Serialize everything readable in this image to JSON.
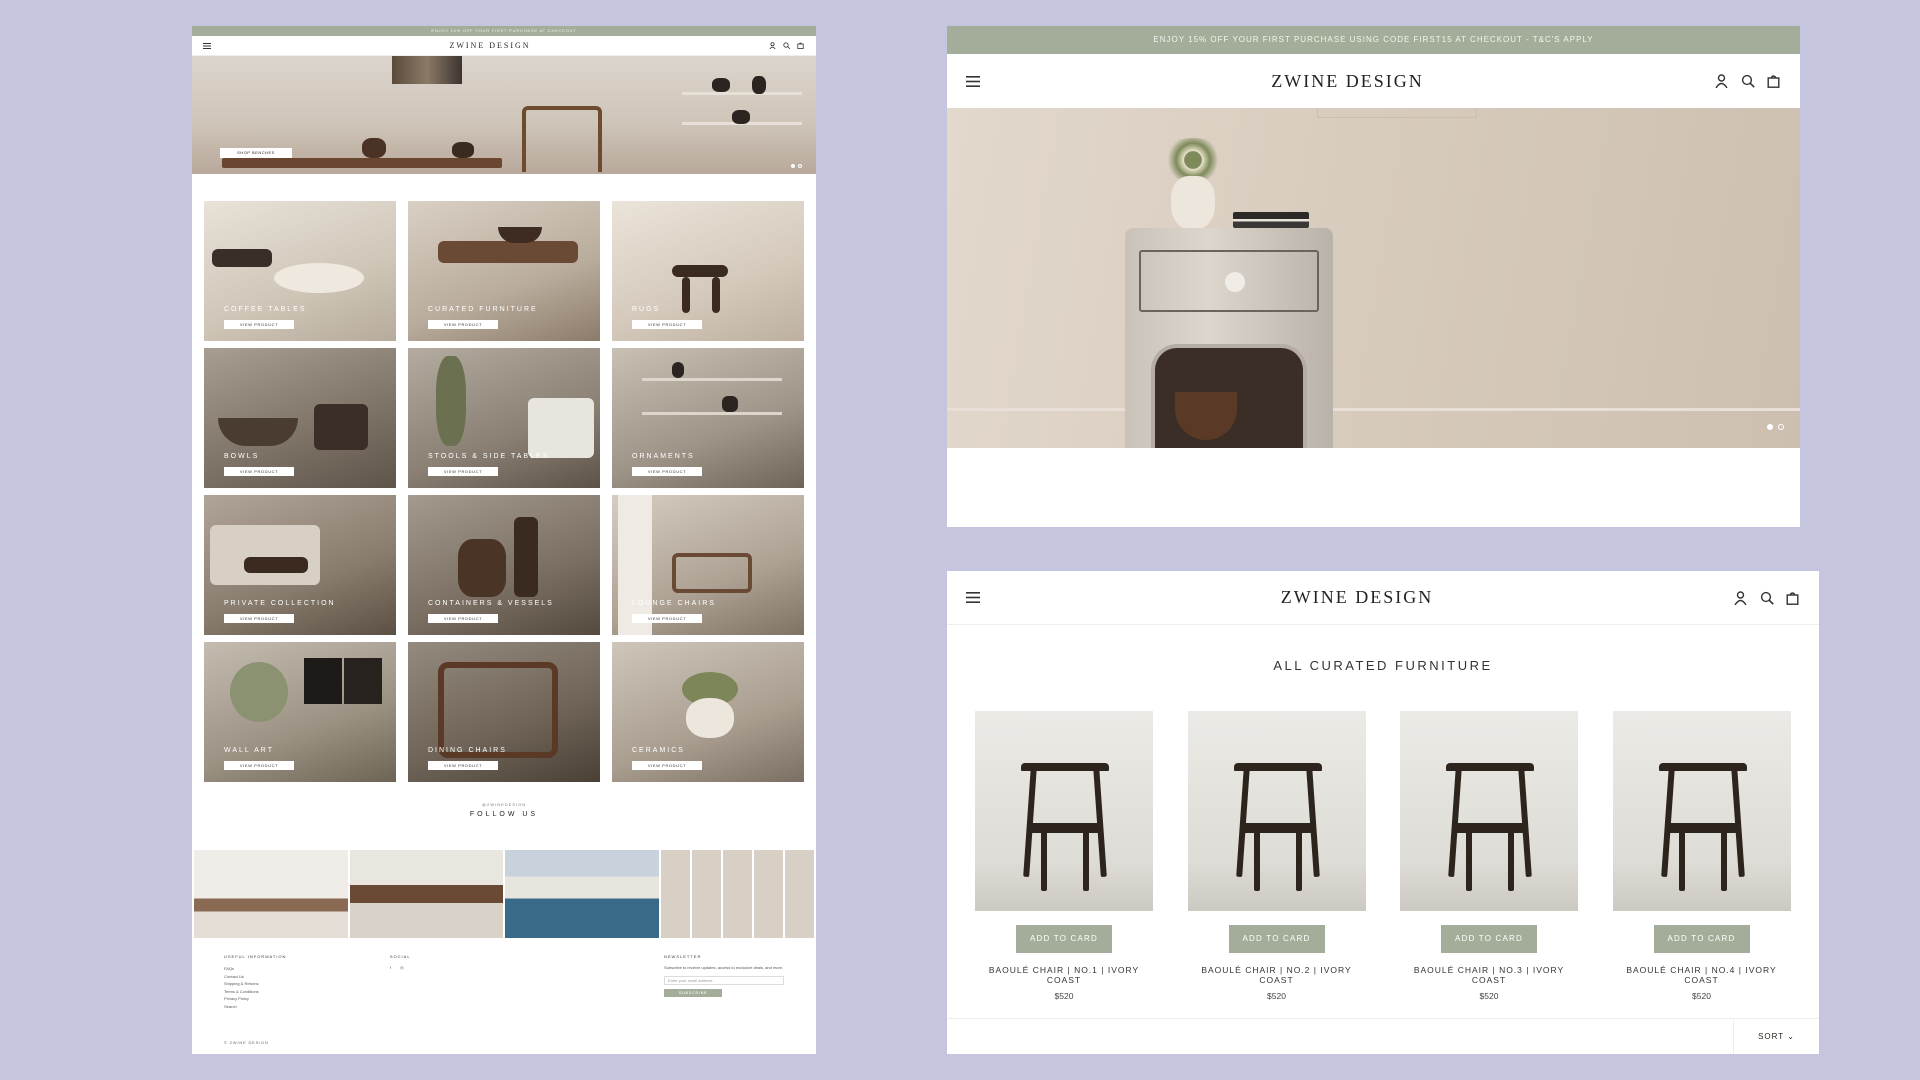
{
  "left": {
    "promo": "ENJOY 10% OFF YOUR FIRST PURCHASE AT CHECKOUT",
    "logo": "ZWINE DESIGN",
    "hero_cta": "SHOP BENCHES",
    "categories": [
      {
        "label": "COFFEE TABLES",
        "button": "VIEW PRODUCT"
      },
      {
        "label": "CURATED FURNITURE",
        "button": "VIEW PRODUCT"
      },
      {
        "label": "RUGS",
        "button": "VIEW PRODUCT"
      },
      {
        "label": "BOWLS",
        "button": "VIEW PRODUCT"
      },
      {
        "label": "STOOLS & SIDE TABLES",
        "button": "VIEW PRODUCT"
      },
      {
        "label": "ORNAMENTS",
        "button": "VIEW PRODUCT"
      },
      {
        "label": "PRIVATE COLLECTION",
        "button": "VIEW PRODUCT"
      },
      {
        "label": "CONTAINERS & VESSELS",
        "button": "VIEW PRODUCT"
      },
      {
        "label": "LOUNGE CHAIRS",
        "button": "VIEW PRODUCT"
      },
      {
        "label": "WALL ART",
        "button": "VIEW PRODUCT"
      },
      {
        "label": "DINING CHAIRS",
        "button": "VIEW PRODUCT"
      },
      {
        "label": "CERAMICS",
        "button": "VIEW PRODUCT"
      }
    ],
    "follow_handle": "@ZWINEDESIGN",
    "follow_title": "FOLLOW US",
    "footer": {
      "useful_title": "USEFUL INFORMATION",
      "useful_links": [
        "FAQs",
        "Contact Us",
        "Shipping & Returns",
        "Terms & Conditions",
        "Privacy Policy",
        "Search"
      ],
      "social_title": "SOCIAL",
      "social_icons": [
        "f",
        "◎"
      ],
      "newsletter_title": "NEWSLETTER",
      "newsletter_text": "Subscribe to receive updates, access to exclusive deals, and more.",
      "newsletter_placeholder": "Enter your email address",
      "newsletter_button": "SUBSCRIBE"
    },
    "copyright": "© ZWINE DESIGN"
  },
  "right_top": {
    "promo": "ENJOY 15% OFF YOUR FIRST PURCHASE USING CODE FIRST15 AT CHECKOUT - T&C'S APPLY",
    "logo": "ZWINE DESIGN"
  },
  "right_bottom": {
    "logo": "ZWINE DESIGN",
    "title": "ALL CURATED FURNITURE",
    "products": [
      {
        "name": "BAOULÉ CHAIR | NO.1 | IVORY COAST",
        "price": "$520",
        "button": "ADD TO CARD"
      },
      {
        "name": "BAOULÉ CHAIR | NO.2 | IVORY COAST",
        "price": "$520",
        "button": "ADD TO CARD"
      },
      {
        "name": "BAOULÉ CHAIR | NO.3 | IVORY COAST",
        "price": "$520",
        "button": "ADD TO CARD"
      },
      {
        "name": "BAOULÉ CHAIR | NO.4 | IVORY COAST",
        "price": "$520",
        "button": "ADD TO CARD"
      }
    ],
    "sort_label": "SORT ⌄"
  },
  "colors": {
    "background": "#c5c5e0",
    "accent_sage": "#a4ad99",
    "wood_dark": "#2e241e"
  },
  "icons": [
    "menu-icon",
    "user-icon",
    "search-icon",
    "cart-icon"
  ]
}
